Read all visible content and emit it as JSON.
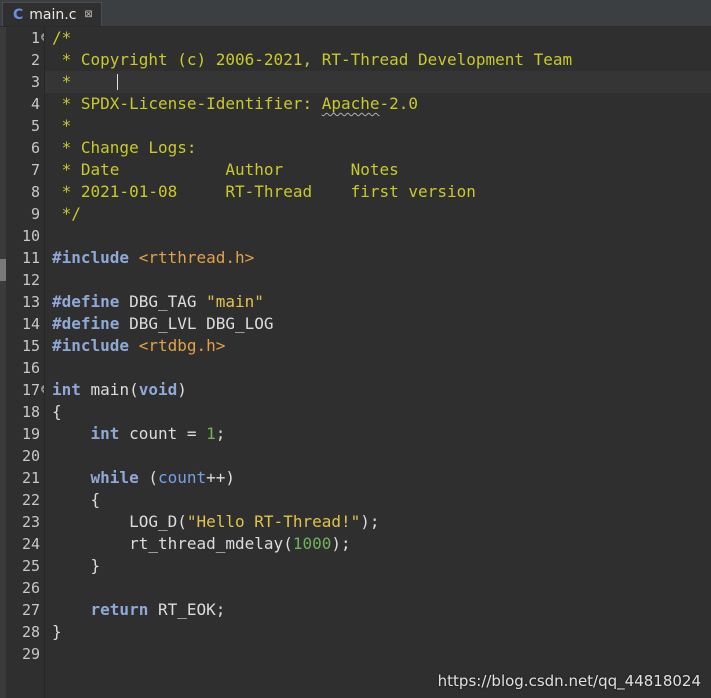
{
  "tab": {
    "icon": "C",
    "title": "main.c",
    "close": "⊠"
  },
  "editor": {
    "current_line": 3,
    "lines": [
      {
        "n": "1",
        "fold": true,
        "tokens": [
          {
            "t": "/*",
            "c": "comment"
          }
        ]
      },
      {
        "n": "2",
        "tokens": [
          {
            "t": " * Copyright (c) 2006-2021, RT-Thread Development Team",
            "c": "comment"
          }
        ]
      },
      {
        "n": "3",
        "tokens": [
          {
            "t": " *",
            "c": "comment"
          }
        ]
      },
      {
        "n": "4",
        "tokens": [
          {
            "t": " * SPDX-License-Identifier: ",
            "c": "comment"
          },
          {
            "t": "Apache",
            "c": "comment spell"
          },
          {
            "t": "-2.0",
            "c": "comment"
          }
        ]
      },
      {
        "n": "5",
        "tokens": [
          {
            "t": " *",
            "c": "comment"
          }
        ]
      },
      {
        "n": "6",
        "tokens": [
          {
            "t": " * Change Logs:",
            "c": "comment"
          }
        ]
      },
      {
        "n": "7",
        "tokens": [
          {
            "t": " * Date           Author       Notes",
            "c": "comment"
          }
        ]
      },
      {
        "n": "8",
        "tokens": [
          {
            "t": " * 2021-01-08     RT-Thread    first version",
            "c": "comment"
          }
        ]
      },
      {
        "n": "9",
        "tokens": [
          {
            "t": " */",
            "c": "comment"
          }
        ]
      },
      {
        "n": "10",
        "tokens": []
      },
      {
        "n": "11",
        "tokens": [
          {
            "t": "#include",
            "c": "pre"
          },
          {
            "t": " ",
            "c": "plain"
          },
          {
            "t": "<rtthread.h>",
            "c": "incl"
          }
        ]
      },
      {
        "n": "12",
        "tokens": []
      },
      {
        "n": "13",
        "tokens": [
          {
            "t": "#define",
            "c": "pre"
          },
          {
            "t": " DBG_TAG ",
            "c": "plain"
          },
          {
            "t": "\"main\"",
            "c": "str"
          }
        ]
      },
      {
        "n": "14",
        "tokens": [
          {
            "t": "#define",
            "c": "pre"
          },
          {
            "t": " DBG_LVL DBG_LOG",
            "c": "plain"
          }
        ]
      },
      {
        "n": "15",
        "tokens": [
          {
            "t": "#include",
            "c": "pre"
          },
          {
            "t": " ",
            "c": "plain"
          },
          {
            "t": "<rtdbg.h>",
            "c": "incl"
          }
        ]
      },
      {
        "n": "16",
        "tokens": []
      },
      {
        "n": "17",
        "fold": true,
        "tokens": [
          {
            "t": "int",
            "c": "kw"
          },
          {
            "t": " main(",
            "c": "plain"
          },
          {
            "t": "void",
            "c": "kw"
          },
          {
            "t": ")",
            "c": "plain"
          }
        ]
      },
      {
        "n": "18",
        "tokens": [
          {
            "t": "{",
            "c": "plain"
          }
        ]
      },
      {
        "n": "19",
        "tokens": [
          {
            "t": "    ",
            "c": "plain"
          },
          {
            "t": "int",
            "c": "kw"
          },
          {
            "t": " count = ",
            "c": "plain"
          },
          {
            "t": "1",
            "c": "num"
          },
          {
            "t": ";",
            "c": "plain"
          }
        ]
      },
      {
        "n": "20",
        "tokens": []
      },
      {
        "n": "21",
        "tokens": [
          {
            "t": "    ",
            "c": "plain"
          },
          {
            "t": "while",
            "c": "kw"
          },
          {
            "t": " (",
            "c": "plain"
          },
          {
            "t": "count",
            "c": "var"
          },
          {
            "t": "++)",
            "c": "plain"
          }
        ]
      },
      {
        "n": "22",
        "tokens": [
          {
            "t": "    {",
            "c": "plain"
          }
        ]
      },
      {
        "n": "23",
        "tokens": [
          {
            "t": "        LOG_D(",
            "c": "plain"
          },
          {
            "t": "\"Hello RT-Thread!\"",
            "c": "str"
          },
          {
            "t": ");",
            "c": "plain"
          }
        ]
      },
      {
        "n": "24",
        "tokens": [
          {
            "t": "        rt_thread_mdelay(",
            "c": "plain"
          },
          {
            "t": "1000",
            "c": "num"
          },
          {
            "t": ");",
            "c": "plain"
          }
        ]
      },
      {
        "n": "25",
        "tokens": [
          {
            "t": "    }",
            "c": "plain"
          }
        ]
      },
      {
        "n": "26",
        "tokens": []
      },
      {
        "n": "27",
        "tokens": [
          {
            "t": "    ",
            "c": "plain"
          },
          {
            "t": "return",
            "c": "kw"
          },
          {
            "t": " RT_EOK;",
            "c": "plain"
          }
        ]
      },
      {
        "n": "28",
        "tokens": [
          {
            "t": "}",
            "c": "plain"
          }
        ]
      },
      {
        "n": "29",
        "tokens": []
      }
    ]
  },
  "watermark": "https://blog.csdn.net/qq_44818024",
  "colors": {
    "background": "#2f2f2f",
    "comment": "#c9c92a",
    "keyword": "#8fa9d6",
    "include_path": "#e0a348",
    "string": "#e0c44a",
    "number": "#6fb35a",
    "variable": "#74a0e6",
    "plain": "#dcdcdc"
  }
}
